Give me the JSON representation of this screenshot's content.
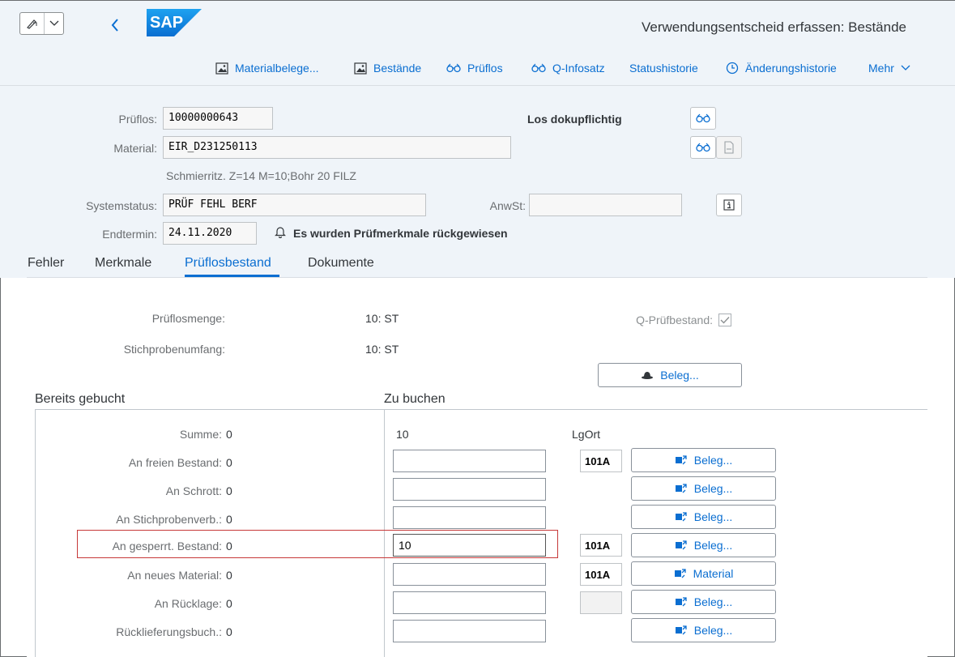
{
  "shell": {
    "title": "Verwendungsentscheid erfassen: Bestände",
    "logo_text": "SAP"
  },
  "toolbar": {
    "items": [
      {
        "label": "Materialbelege...",
        "icon": "image-icon"
      },
      {
        "label": "Bestände",
        "icon": "image-icon"
      },
      {
        "label": "Prüflos",
        "icon": "glasses-icon"
      },
      {
        "label": "Q-Infosatz",
        "icon": "glasses-icon"
      },
      {
        "label": "Statushistorie",
        "icon": ""
      },
      {
        "label": "Änderungshistorie",
        "icon": "clock-icon"
      },
      {
        "label": "Mehr",
        "icon": "chevron-down-icon"
      }
    ]
  },
  "header": {
    "prueflos_label": "Prüflos:",
    "prueflos_value": "10000000643",
    "material_label": "Material:",
    "material_value": "EIR_D231250113",
    "material_desc": "Schmierritz. Z=14 M=10;Bohr 20 FILZ",
    "systemstatus_label": "Systemstatus:",
    "systemstatus_value": "PRÜF FEHL BERF",
    "anwst_label": "AnwSt:",
    "anwst_value": "",
    "endtermin_label": "Endtermin:",
    "endtermin_value": "24.11.2020",
    "notice": "Es wurden Prüfmerkmale rückgewiesen",
    "dokupflichtig": "Los dokupflichtig"
  },
  "tabs": [
    {
      "label": "Fehler"
    },
    {
      "label": "Merkmale"
    },
    {
      "label": "Prüflosbestand",
      "active": true
    },
    {
      "label": "Dokumente"
    }
  ],
  "summary": {
    "prueflosmenge_label": "Prüflosmenge:",
    "prueflosmenge_value": "10: ST",
    "stichprobe_label": "Stichprobenumfang:",
    "stichprobe_value": "10: ST",
    "qpruef_label": "Q-Prüfbestand:",
    "qpruef_checked": true,
    "beleg_label": "Beleg..."
  },
  "booking": {
    "bereits_title": "Bereits gebucht",
    "zu_buchen_title": "Zu buchen",
    "zu_buchen_total": "10",
    "lgort_header": "LgOrt",
    "rows": [
      {
        "label": "Summe:",
        "value": "0"
      },
      {
        "label": "An freien Bestand:",
        "value": "0",
        "input": "",
        "lgort": "101A",
        "button": "Beleg..."
      },
      {
        "label": "An Schrott:",
        "value": "0",
        "input": "",
        "button": "Beleg..."
      },
      {
        "label": "An Stichprobenverb.:",
        "value": "0",
        "input": "",
        "button": "Beleg..."
      },
      {
        "label": "An gesperrt. Bestand:",
        "value": "0",
        "input": "10",
        "lgort": "101A",
        "button": "Beleg..."
      },
      {
        "label": "An neues Material:",
        "value": "0",
        "input": "",
        "lgort": "101A",
        "button": "Material"
      },
      {
        "label": "An Rücklage:",
        "value": "0",
        "input": "",
        "button": "Beleg..."
      },
      {
        "label": "Rücklieferungsbuch.:",
        "value": "0",
        "input": "",
        "button": "Beleg..."
      }
    ]
  }
}
